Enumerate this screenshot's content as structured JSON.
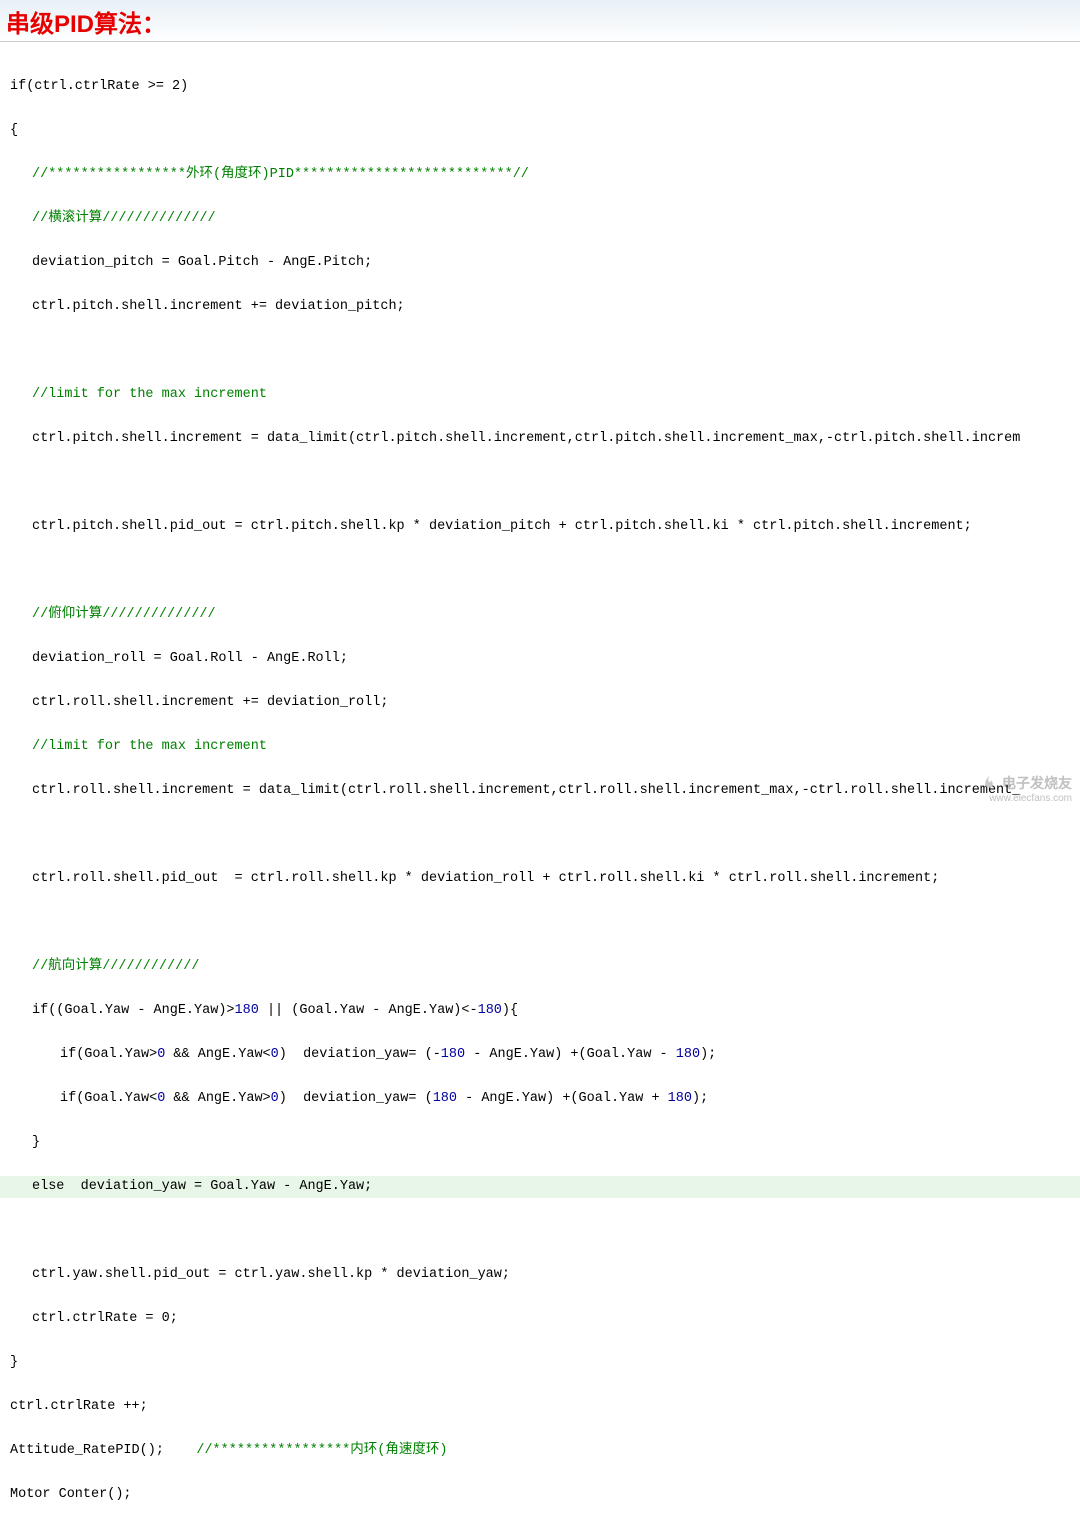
{
  "title": "串级PID算法：",
  "watermark": {
    "brand": "电子发烧友",
    "url": "www.elecfans.com"
  },
  "code": {
    "l1": "if(ctrl.ctrlRate >= 2)",
    "l2": "{",
    "l3a": "//*****************",
    "l3b": "外环",
    "l3c": "(",
    "l3d": "角度环",
    "l3e": ")PID***************************//",
    "l4a": "//",
    "l4b": "横滚计算",
    "l4c": "//////////////",
    "l5": "deviation_pitch = Goal.Pitch - AngE.Pitch;",
    "l6": "ctrl.pitch.shell.increment += deviation_pitch;",
    "l7": "",
    "l8": "//limit for the max increment",
    "l9": "ctrl.pitch.shell.increment = data_limit(ctrl.pitch.shell.increment,ctrl.pitch.shell.increment_max,-ctrl.pitch.shell.increm",
    "l10": "",
    "l11": "ctrl.pitch.shell.pid_out = ctrl.pitch.shell.kp * deviation_pitch + ctrl.pitch.shell.ki * ctrl.pitch.shell.increment;",
    "l12": "",
    "l13a": "//",
    "l13b": "俯仰计算",
    "l13c": "//////////////",
    "l14": "deviation_roll = Goal.Roll - AngE.Roll;",
    "l15": "ctrl.roll.shell.increment += deviation_roll;",
    "l16": "//limit for the max increment",
    "l17": "ctrl.roll.shell.increment = data_limit(ctrl.roll.shell.increment,ctrl.roll.shell.increment_max,-ctrl.roll.shell.increment_",
    "l18": "",
    "l19": "ctrl.roll.shell.pid_out  = ctrl.roll.shell.kp * deviation_roll + ctrl.roll.shell.ki * ctrl.roll.shell.increment;",
    "l20": "",
    "l21a": "//",
    "l21b": "航向计算",
    "l21c": "////////////",
    "l22a": "if((Goal.Yaw - AngE.Yaw)>",
    "l22b": "180",
    "l22c": " || (Goal.Yaw - AngE.Yaw)<-",
    "l22d": "180",
    "l22e": "){",
    "l23a": "if(Goal.Yaw>",
    "l23b": "0",
    "l23c": " && AngE.Yaw<",
    "l23d": "0",
    "l23e": ")  deviation_yaw= (-",
    "l23f": "180",
    "l23g": " - AngE.Yaw) +(Goal.Yaw - ",
    "l23h": "180",
    "l23i": ");",
    "l24a": "if(Goal.Yaw<",
    "l24b": "0",
    "l24c": " && AngE.Yaw>",
    "l24d": "0",
    "l24e": ")  deviation_yaw= (",
    "l24f": "180",
    "l24g": " - AngE.Yaw) +(Goal.Yaw + ",
    "l24h": "180",
    "l24i": ");",
    "l25": "}",
    "l26": "else  deviation_yaw = Goal.Yaw - AngE.Yaw;",
    "l27": "",
    "l28": "ctrl.yaw.shell.pid_out = ctrl.yaw.shell.kp * deviation_yaw;",
    "l29": "ctrl.ctrlRate = 0;",
    "l30": "}",
    "l31": "ctrl.ctrlRate ++;",
    "l32a": "Attitude_RatePID();    ",
    "l32b": "//*****************",
    "l32c": "内环",
    "l32d": "(",
    "l32e": "角速度环",
    "l32f": ")",
    "l33": "Motor Conter();"
  }
}
